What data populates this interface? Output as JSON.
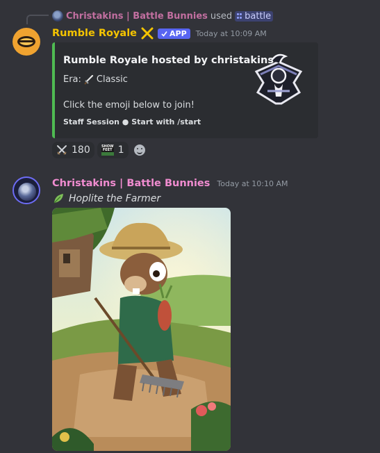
{
  "reply": {
    "username": "Christakins | Battle Bunnies",
    "used_text": "used",
    "command": "battle"
  },
  "message1": {
    "username": "Rumble Royale",
    "app_badge": "APP",
    "timestamp": "Today at 10:09 AM",
    "embed": {
      "title": "Rumble Royale hosted by christakins",
      "era_label": "Era:",
      "era_value": "Classic",
      "join_text": "Click the emoji below to join!",
      "footer": "Staff Session ● Start with /start",
      "accent_color": "#4fbb52"
    },
    "reactions": [
      {
        "icon": "crossed-swords-icon",
        "count": "180"
      },
      {
        "icon": "show-feet-emoji-icon",
        "count": "1"
      }
    ]
  },
  "message2": {
    "username": "Christakins | Battle Bunnies",
    "timestamp": "Today at 10:10 AM",
    "text": "Hoplite the Farmer",
    "image_icon": "hoplite-farmer-artwork"
  },
  "colors": {
    "background": "#323339",
    "bot_name": "#f5c400",
    "user_name": "#f08cd0",
    "app_badge": "#5865f2"
  }
}
